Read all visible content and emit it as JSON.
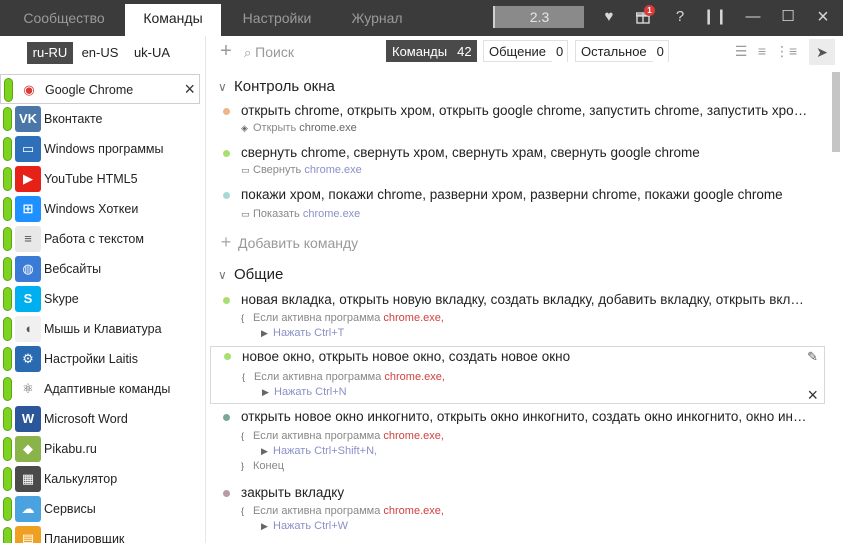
{
  "titlebar": {
    "tabs": [
      "Сообщество",
      "Команды",
      "Настройки",
      "Журнал"
    ],
    "active_tab": "Команды",
    "version": "2.3",
    "notification_count": "1",
    "icons": [
      "heart-icon",
      "gift-icon",
      "help-icon",
      "pause-icon",
      "minimize-icon",
      "maximize-icon",
      "close-icon"
    ]
  },
  "languages": [
    "ru-RU",
    "en-US",
    "uk-UA"
  ],
  "active_language": "ru-RU",
  "apps": [
    {
      "name": "Google Chrome",
      "icon": "chrome-icon",
      "color": "#ffffff"
    },
    {
      "name": "Вконтакте",
      "icon": "vk-icon",
      "color": "#4a76a8"
    },
    {
      "name": "Windows программы",
      "icon": "monitor-icon",
      "color": "#2d6fb8"
    },
    {
      "name": "YouTube HTML5",
      "icon": "youtube-icon",
      "color": "#e62117"
    },
    {
      "name": "Windows Хоткеи",
      "icon": "windows-icon",
      "color": "#1e90ff"
    },
    {
      "name": "Работа с текстом",
      "icon": "document-icon",
      "color": "#e8e8e8"
    },
    {
      "name": "Вебсайты",
      "icon": "globe-icon",
      "color": "#3a7bd5"
    },
    {
      "name": "Skype",
      "icon": "skype-icon",
      "color": "#00aff0"
    },
    {
      "name": "Мышь и Клавиатура",
      "icon": "mouse-icon",
      "color": "#f0f0f0"
    },
    {
      "name": "Настройки Laitis",
      "icon": "settings-icon",
      "color": "#2a6ab0"
    },
    {
      "name": "Адаптивные команды",
      "icon": "atom-icon",
      "color": "#ffffff"
    },
    {
      "name": "Microsoft Word",
      "icon": "word-icon",
      "color": "#2b579a"
    },
    {
      "name": "Pikabu.ru",
      "icon": "pikabu-icon",
      "color": "#8ab34a"
    },
    {
      "name": "Калькулятор",
      "icon": "calculator-icon",
      "color": "#4a4a4a"
    },
    {
      "name": "Сервисы",
      "icon": "cloud-icon",
      "color": "#4aa3df"
    },
    {
      "name": "Планировщик",
      "icon": "calendar-icon",
      "color": "#f0a020"
    }
  ],
  "selected_app": "Google Chrome",
  "toolbar": {
    "search_placeholder": "Поиск",
    "filters": [
      {
        "label": "Команды",
        "count": "42"
      },
      {
        "label": "Общение",
        "count": "0"
      },
      {
        "label": "Остальное",
        "count": "0"
      }
    ],
    "active_filter": "Команды"
  },
  "groups": [
    {
      "title": "Контроль окна",
      "commands": [
        {
          "dot": "#f0b48a",
          "phrase": "открыть chrome, открыть хром, открыть google chrome, запустить chrome, запустить хром, запустить google chrome",
          "action_label": "Открыть",
          "action_value": "chrome.exe"
        },
        {
          "dot": "#a8e070",
          "phrase": "свернуть chrome, свернуть хром, свернуть храм, свернуть google chrome",
          "action_label": "Свернуть",
          "action_value": "chrome.exe"
        },
        {
          "dot": "#a8d8d8",
          "phrase": "покажи хром, покажи chrome, разверни хром, разверни chrome, покажи google chrome",
          "action_label": "Показать",
          "action_value": "chrome.exe"
        }
      ]
    },
    {
      "title": "Общие",
      "commands": [
        {
          "dot": "#a8e070",
          "phrase": "новая вкладка, открыть новую вкладку, создать вкладку, добавить вкладку, открыть вкладку",
          "cond_label": "Если активна программа",
          "cond_value": "chrome.exe,",
          "key": "Нажать Ctrl+T"
        },
        {
          "dot": "#a8e070",
          "phrase": "новое окно, открыть новое окно, создать новое окно",
          "cond_label": "Если активна программа",
          "cond_value": "chrome.exe,",
          "key": "Нажать Ctrl+N"
        },
        {
          "dot": "#7aa898",
          "phrase": "открыть новое окно инкогнито, открыть окно инкогнито, создать окно инкогнито, окно инкогнито",
          "cond_label": "Если активна программа",
          "cond_value": "chrome.exe,",
          "key": "Нажать Ctrl+Shift+N,",
          "end": "Конец"
        },
        {
          "dot": "#b89aa8",
          "phrase": "закрыть вкладку",
          "cond_label": "Если активна программа",
          "cond_value": "chrome.exe,",
          "key": "Нажать Ctrl+W"
        }
      ]
    }
  ],
  "add_command_label": "Добавить команду"
}
